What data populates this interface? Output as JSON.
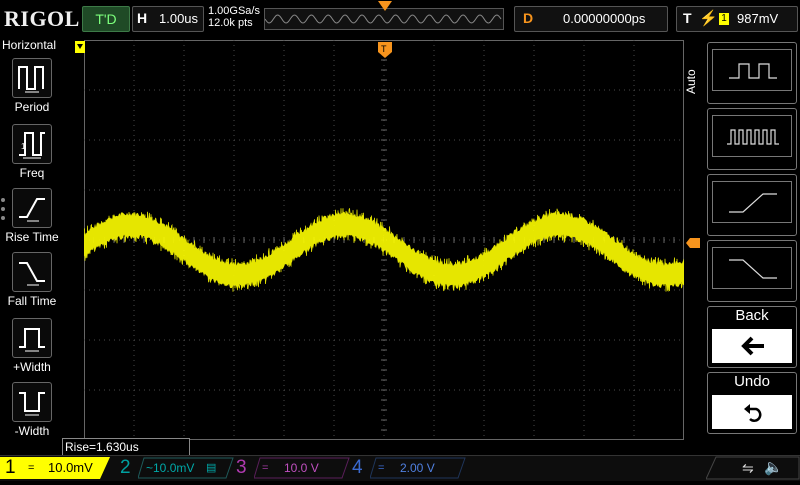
{
  "brand": "RIGOL",
  "top": {
    "run_state": "T'D",
    "timebase_label": "H",
    "timebase_value": "1.00us",
    "sample_rate": "1.00GSa/s",
    "memory_depth": "12.0k pts",
    "trig_pos_marker": "T",
    "delay_label": "D",
    "delay_value": "0.00000000ps",
    "trigger_label": "T",
    "trigger_source": "1",
    "trigger_level": "987mV"
  },
  "left_menu": {
    "title": "Horizontal",
    "items": [
      {
        "label": "Period",
        "icon": "period-icon"
      },
      {
        "label": "Freq",
        "icon": "frequency-icon"
      },
      {
        "label": "Rise Time",
        "icon": "rise-time-icon"
      },
      {
        "label": "Fall Time",
        "icon": "fall-time-icon"
      },
      {
        "label": "+Width",
        "icon": "positive-width-icon"
      },
      {
        "label": "-Width",
        "icon": "negative-width-icon"
      }
    ]
  },
  "right_menu": {
    "mode_label": "Auto",
    "back_label": "Back",
    "undo_label": "Undo"
  },
  "measurement": {
    "readout": "Rise=1.630us"
  },
  "channels": [
    {
      "num": "1",
      "setting": "10.0mV",
      "coupling": "=",
      "color": "#ffff00",
      "active": true
    },
    {
      "num": "2",
      "setting": "~10.0mV",
      "color": "#00c8c8",
      "active": false
    },
    {
      "num": "3",
      "setting": "10.0 V",
      "coupling": "=",
      "color": "#e040e0",
      "active": false
    },
    {
      "num": "4",
      "setting": "2.00 V",
      "coupling": "=",
      "color": "#4080ff",
      "active": false
    }
  ],
  "colors": {
    "ch1": "#ffff00",
    "trigger": "#f7941d",
    "grid": "#4a4a4a"
  },
  "waveform": {
    "cycles_shown": 2.8,
    "amplitude_divisions": 0.5,
    "center_offset_divisions": 0.2
  }
}
